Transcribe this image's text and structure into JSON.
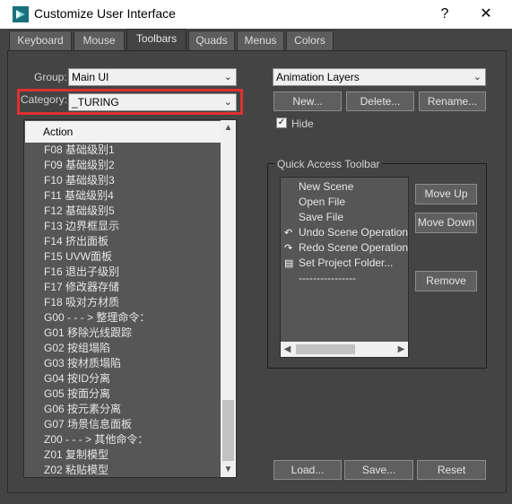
{
  "window": {
    "title": "Customize User Interface",
    "help_label": "?",
    "close_label": "✕"
  },
  "tabs": [
    {
      "label": "Keyboard",
      "active": false
    },
    {
      "label": "Mouse",
      "active": false
    },
    {
      "label": "Toolbars",
      "active": true
    },
    {
      "label": "Quads",
      "active": false
    },
    {
      "label": "Menus",
      "active": false
    },
    {
      "label": "Colors",
      "active": false
    }
  ],
  "group": {
    "label": "Group:",
    "value": "Main UI"
  },
  "category": {
    "label": "Category:",
    "value": "_TURING"
  },
  "action_list": {
    "header": "Action",
    "items": [
      "F08 基础级别1",
      "F09 基础级别2",
      "F10 基础级别3",
      "F11 基础级别4",
      "F12 基础级别5",
      "F13 边界框显示",
      "F14 挤出面板",
      "F15 UVW面板",
      "F16 退出子级别",
      "F17 修改器存储",
      "F18 吸对方材质",
      "G00 - - - > 整理命令：",
      "G01 移除光线跟踪",
      "G02 按组塌陷",
      "G03 按材质塌陷",
      "G04 按ID分离",
      "G05 按面分离",
      "G06 按元素分离",
      "G07 场景信息面板",
      "Z00 - - - > 其他命令：",
      "Z01 复制模型",
      "Z02 粘贴模型"
    ]
  },
  "toolbar_select": {
    "value": "Animation Layers"
  },
  "toolbar_buttons": {
    "new": "New...",
    "delete": "Delete...",
    "rename": "Rename..."
  },
  "hide": {
    "label": "Hide",
    "checked": true,
    "check_glyph": "✓"
  },
  "qat": {
    "title": "Quick Access Toolbar",
    "items": [
      {
        "label": "New Scene",
        "icon": ""
      },
      {
        "label": "Open File",
        "icon": ""
      },
      {
        "label": "Save File",
        "icon": ""
      },
      {
        "label": "Undo Scene Operation",
        "icon": "undo-icon"
      },
      {
        "label": "Redo Scene Operation",
        "icon": "redo-icon"
      },
      {
        "label": "Set Project Folder...",
        "icon": "project-folder-icon"
      },
      {
        "label": "----------------",
        "icon": ""
      }
    ],
    "move_up": "Move Up",
    "move_down": "Move Down",
    "remove": "Remove"
  },
  "footer": {
    "load": "Load...",
    "save": "Save...",
    "reset": "Reset"
  },
  "colors": {
    "highlight_box": "#e03030",
    "panel_bg": "#444444",
    "list_bg": "#565656"
  }
}
